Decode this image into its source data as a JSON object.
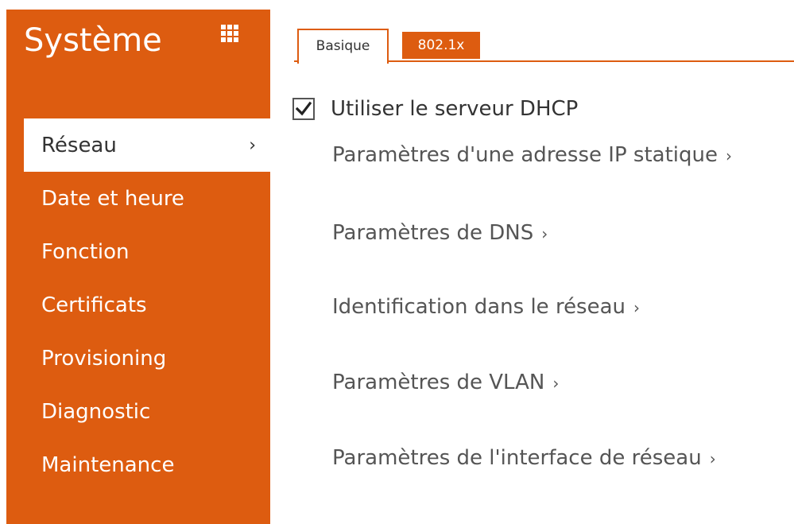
{
  "sidebar": {
    "title": "Système",
    "apps_icon": "grid-apps-icon",
    "items": [
      {
        "label": "Réseau",
        "active": true,
        "chevron": "›"
      },
      {
        "label": "Date et heure",
        "active": false
      },
      {
        "label": "Fonction",
        "active": false
      },
      {
        "label": "Certificats",
        "active": false
      },
      {
        "label": "Provisioning",
        "active": false
      },
      {
        "label": "Diagnostic",
        "active": false
      },
      {
        "label": "Maintenance",
        "active": false
      }
    ]
  },
  "tabs": [
    {
      "label": "Basique",
      "active": true
    },
    {
      "label": "802.1x",
      "active": false
    }
  ],
  "main": {
    "dhcp": {
      "label": "Utiliser le serveur DHCP",
      "checked": true
    },
    "links": [
      {
        "label": "Paramètres d'une adresse IP statique",
        "chevron": "›"
      },
      {
        "label": "Paramètres de DNS",
        "chevron": "›"
      },
      {
        "label": "Identification dans le réseau",
        "chevron": "›"
      },
      {
        "label": "Paramètres de VLAN",
        "chevron": "›"
      },
      {
        "label": "Paramètres de l'interface de réseau",
        "chevron": "›"
      }
    ]
  },
  "colors": {
    "accent": "#dd5c10",
    "text": "#333333",
    "muted_text": "#555555",
    "background": "#ffffff"
  }
}
